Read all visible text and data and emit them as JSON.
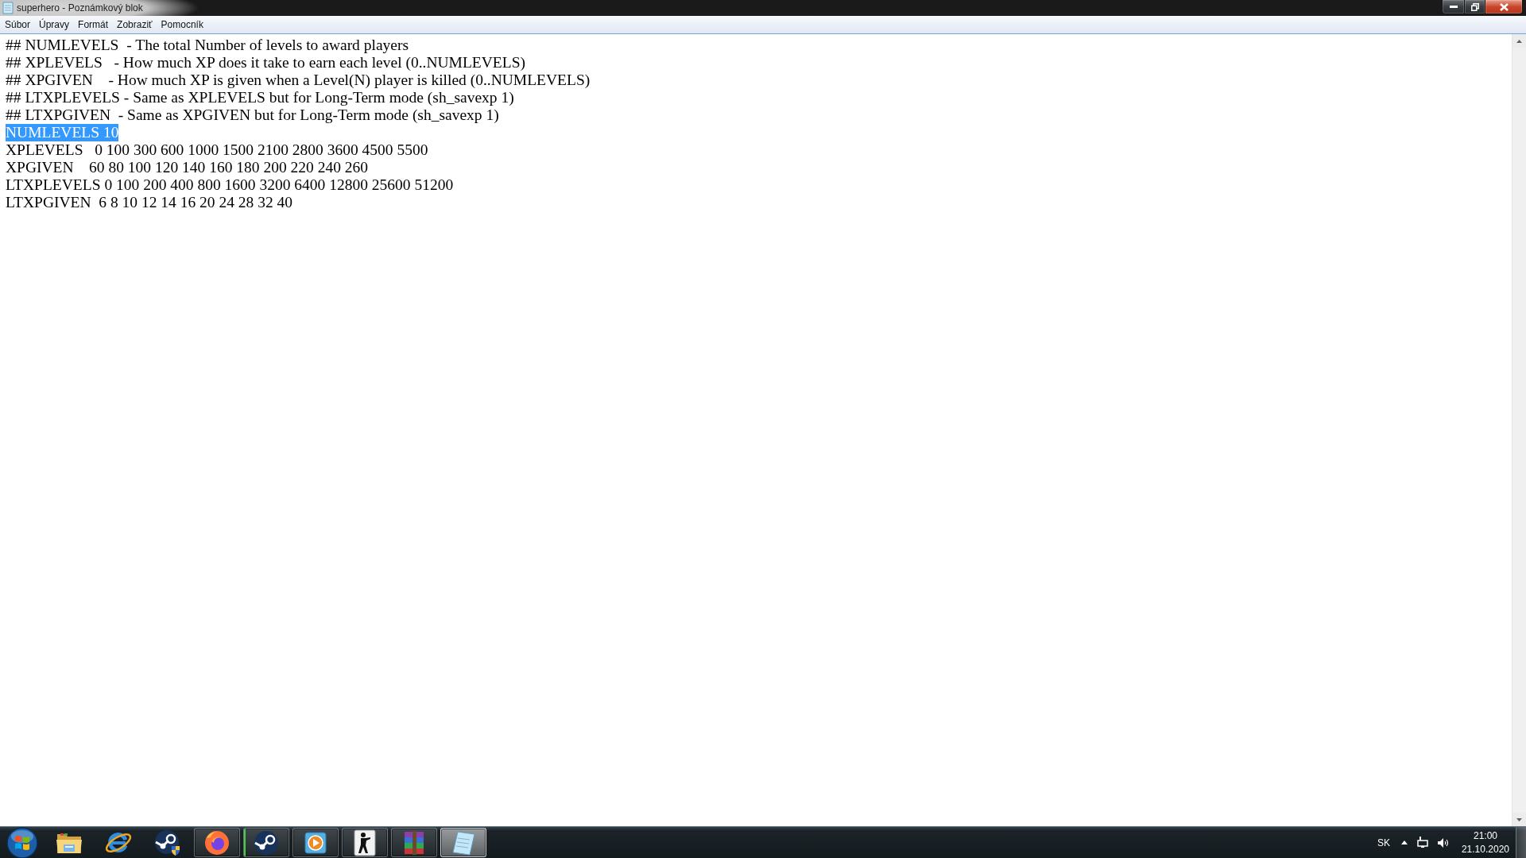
{
  "window": {
    "title": "superhero - Poznámkový blok"
  },
  "menu_items": [
    "Súbor",
    "Úpravy",
    "Formát",
    "Zobraziť",
    "Pomocník"
  ],
  "editor": {
    "lines": [
      {
        "text": "## NUMLEVELS  - The total Number of levels to award players",
        "selected": false
      },
      {
        "text": "## XPLEVELS   - How much XP does it take to earn each level (0..NUMLEVELS)",
        "selected": false
      },
      {
        "text": "## XPGIVEN    - How much XP is given when a Level(N) player is killed (0..NUMLEVELS)",
        "selected": false
      },
      {
        "text": "## LTXPLEVELS - Same as XPLEVELS but for Long-Term mode (sh_savexp 1)",
        "selected": false
      },
      {
        "text": "## LTXPGIVEN  - Same as XPGIVEN but for Long-Term mode (sh_savexp 1)",
        "selected": false
      },
      {
        "text": "NUMLEVELS 10",
        "selected": true
      },
      {
        "text": "XPLEVELS   0 100 300 600 1000 1500 2100 2800 3600 4500 5500",
        "selected": false
      },
      {
        "text": "XPGIVEN    60 80 100 120 140 160 180 200 220 240 260",
        "selected": false
      },
      {
        "text": "LTXPLEVELS 0 100 200 400 800 1600 3200 6400 12800 25600 51200",
        "selected": false
      },
      {
        "text": "LTXPGIVEN  6 8 10 12 14 16 20 24 28 32 40",
        "selected": false
      }
    ]
  },
  "taskbar": {
    "items": [
      {
        "running": false,
        "selected": false
      },
      {
        "running": false,
        "selected": false
      },
      {
        "running": false,
        "selected": false
      },
      {
        "running": true,
        "selected": false
      },
      {
        "running": true,
        "selected": false,
        "level": 0.03
      },
      {
        "running": true,
        "selected": false
      },
      {
        "running": true,
        "selected": false
      },
      {
        "running": true,
        "selected": false
      },
      {
        "running": true,
        "selected": true
      }
    ],
    "tray": {
      "language": "SK",
      "time": "21:00",
      "date": "21.10.2020"
    }
  }
}
